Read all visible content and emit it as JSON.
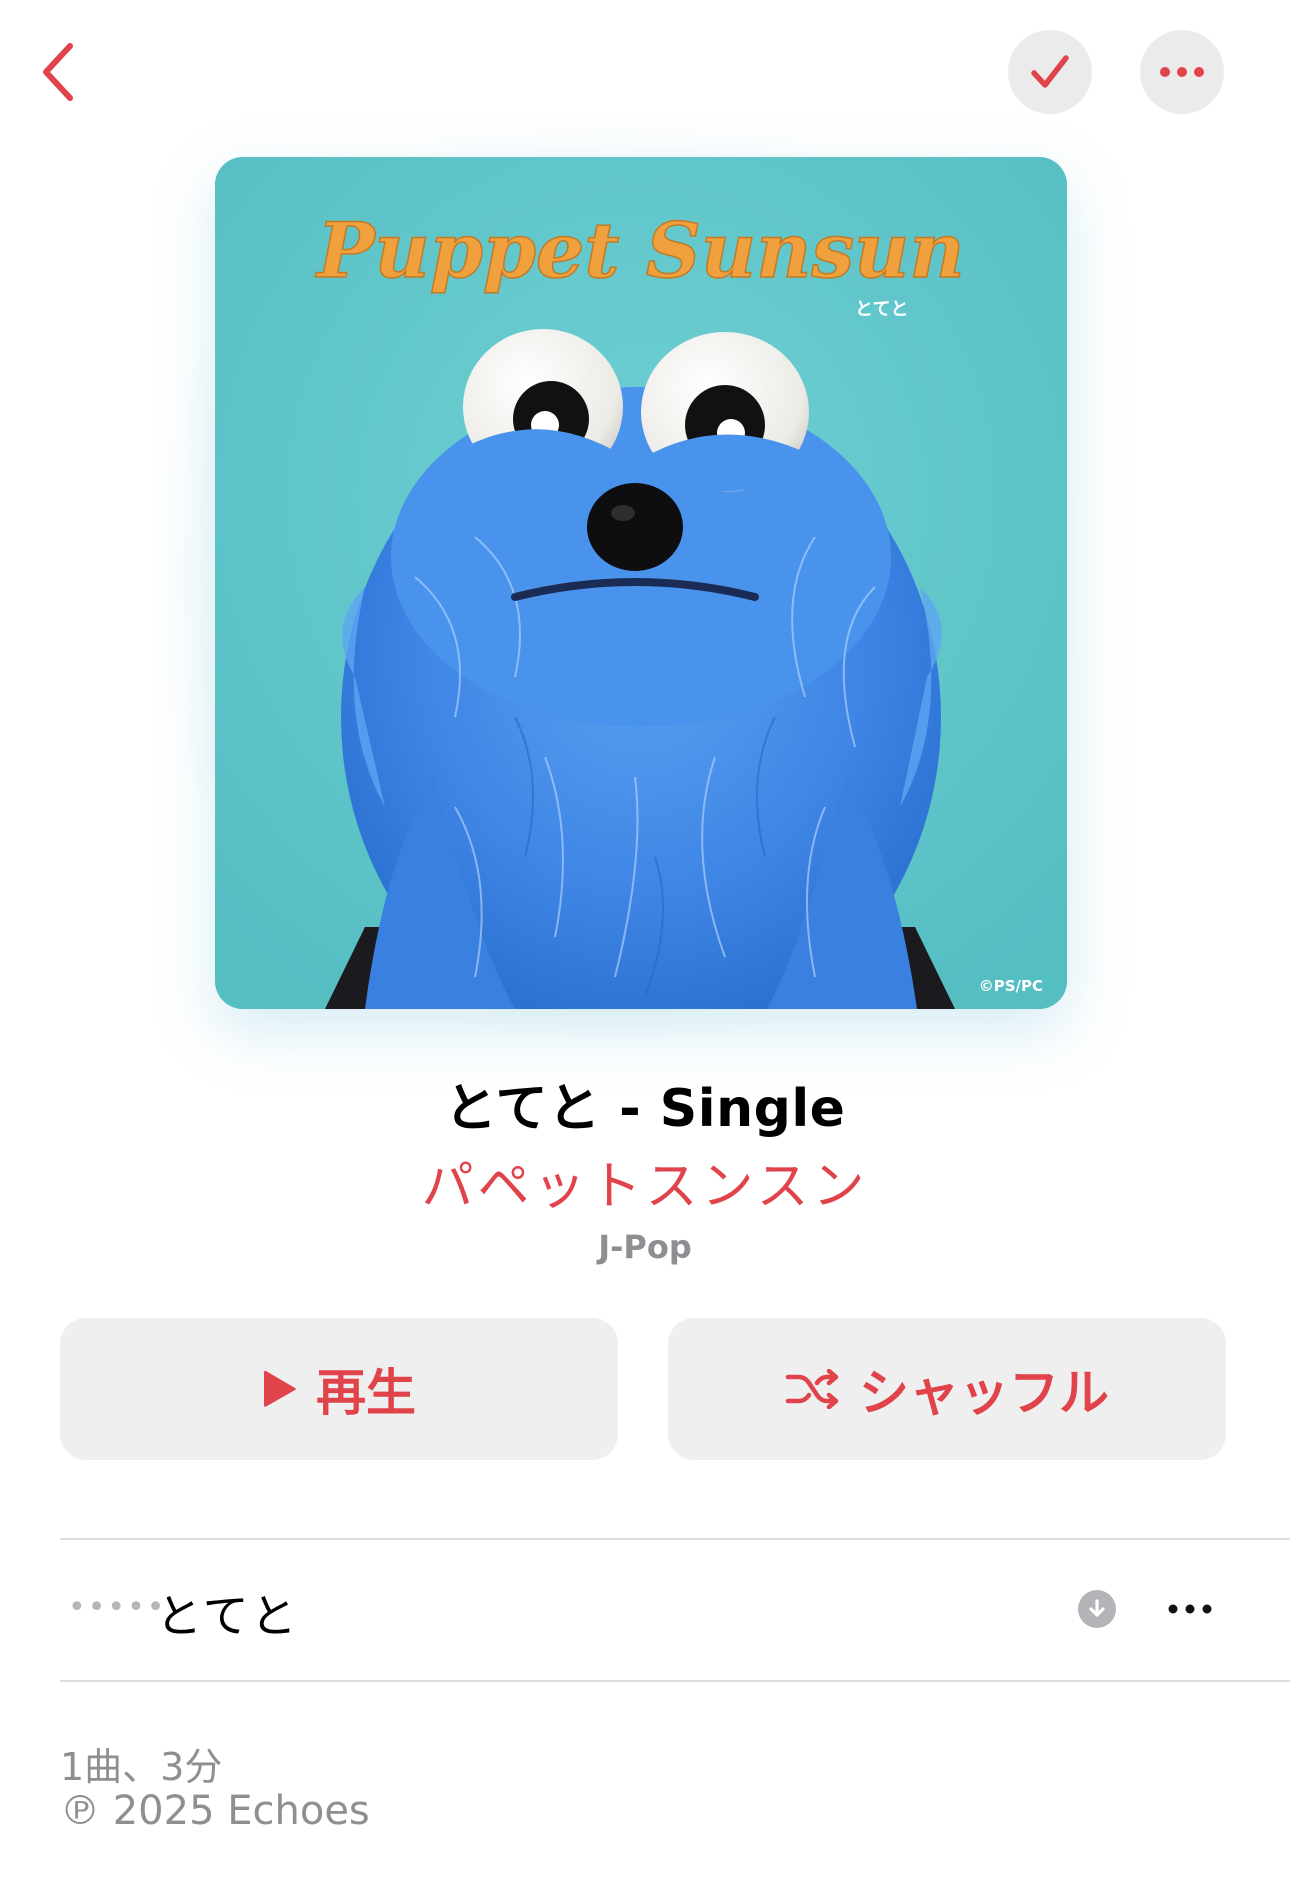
{
  "colors": {
    "accent": "#e0434a",
    "button_bg": "#efefef",
    "secondary_text": "#8e8e93",
    "artwork_bg": "#5fc7cb",
    "puppet_blue": "#3f86e6"
  },
  "nav": {
    "back_icon": "chevron-left-icon",
    "library_icon": "checkmark-icon",
    "more_icon": "ellipsis-icon"
  },
  "artwork": {
    "logo_text": "Puppet Sunsun",
    "logo_subtitle": "とてと",
    "credit": "©PS/PC"
  },
  "album": {
    "title": "とてと - Single",
    "artist": "パペットスンスン",
    "genre": "J-Pop"
  },
  "actions": {
    "play_label": "再生",
    "play_icon": "play-icon",
    "shuffle_label": "シャッフル",
    "shuffle_icon": "shuffle-icon"
  },
  "tracks": [
    {
      "number": "•••••",
      "title": "とてと",
      "download_icon": "download-icon",
      "more_icon": "ellipsis-icon"
    }
  ],
  "footer": {
    "count": "1曲、3分",
    "copyright": "℗ 2025 Echoes"
  }
}
